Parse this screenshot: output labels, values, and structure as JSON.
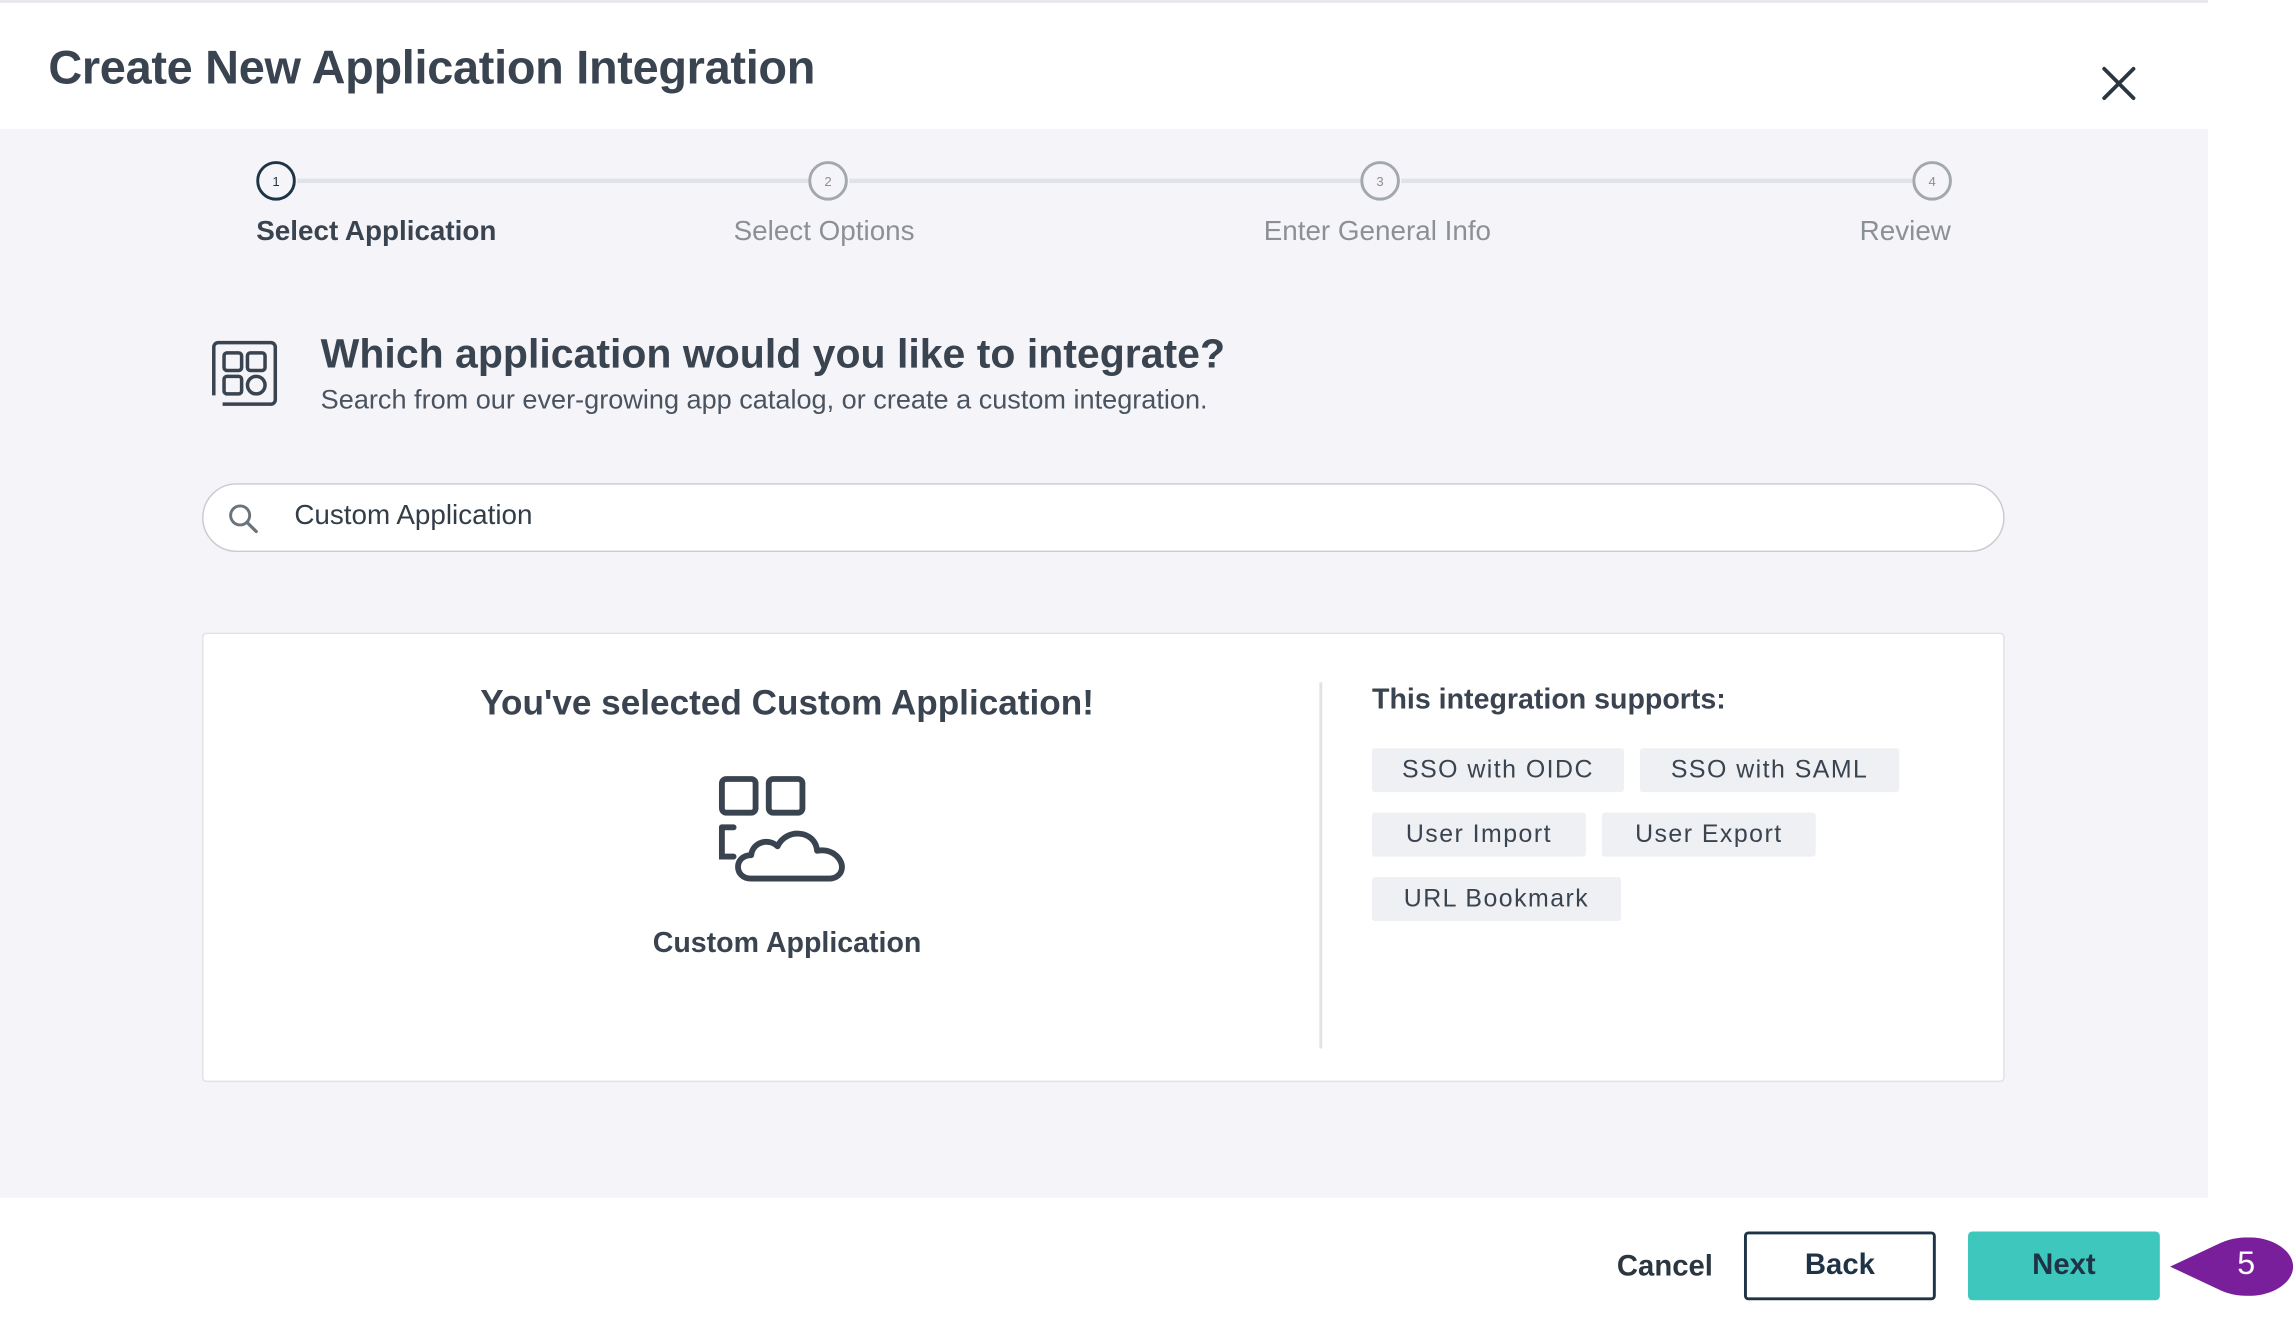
{
  "dialog": {
    "title": "Create New Application Integration"
  },
  "stepper": {
    "steps": [
      {
        "number": "1",
        "label": "Select Application"
      },
      {
        "number": "2",
        "label": "Select Options"
      },
      {
        "number": "3",
        "label": "Enter General Info"
      },
      {
        "number": "4",
        "label": "Review"
      }
    ],
    "active_step": 1
  },
  "question": {
    "title": "Which application would you like to integrate?",
    "subtitle": "Search from our ever-growing app catalog, or create a custom integration."
  },
  "search": {
    "value": "Custom Application"
  },
  "selection": {
    "heading": "You've selected Custom Application!",
    "app_name": "Custom Application",
    "supports_title": "This integration supports:",
    "tags": [
      "SSO with OIDC",
      "SSO with SAML",
      "User Import",
      "User Export",
      "URL Bookmark"
    ]
  },
  "footer": {
    "cancel_label": "Cancel",
    "back_label": "Back",
    "next_label": "Next"
  },
  "annotation": {
    "marker_label": "5"
  },
  "colors": {
    "accent": "#3ec8bd",
    "navy": "#1e3346",
    "panel_bg": "#f5f5f9",
    "marker": "#7a1f9b"
  },
  "icons": [
    "close-icon",
    "app-grid-icon",
    "search-icon",
    "custom-app-cloud-icon"
  ]
}
